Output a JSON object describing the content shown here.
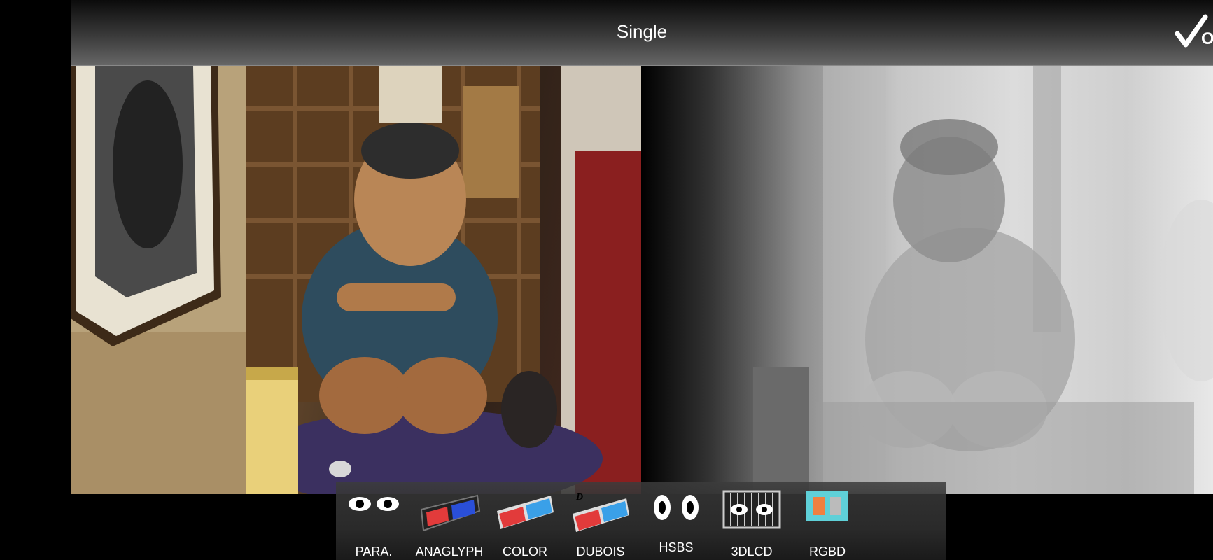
{
  "header": {
    "title": "Single",
    "ok_label": "OK"
  },
  "images": {
    "left": "photo-image",
    "right": "depth-map-image"
  },
  "toolbar": {
    "items": [
      {
        "label": "PARA.",
        "icon": "eyes-icon"
      },
      {
        "label": "ANAGLYPH",
        "icon": "anaglyph-glasses-icon"
      },
      {
        "label": "COLOR",
        "icon": "color-glasses-icon"
      },
      {
        "label": "DUBOIS",
        "icon": "dubois-glasses-icon"
      },
      {
        "label": "HSBS",
        "icon": "hsbs-eyes-icon"
      },
      {
        "label": "3DLCD",
        "icon": "lcd-icon"
      },
      {
        "label": "RGBD",
        "icon": "rgbd-icon"
      }
    ]
  },
  "colors": {
    "anaglyph_red": "#e23b3b",
    "anaglyph_blue": "#3aa0e8",
    "rgbd_orange": "#f08040",
    "rgbd_cyan": "#5fd0d8"
  }
}
